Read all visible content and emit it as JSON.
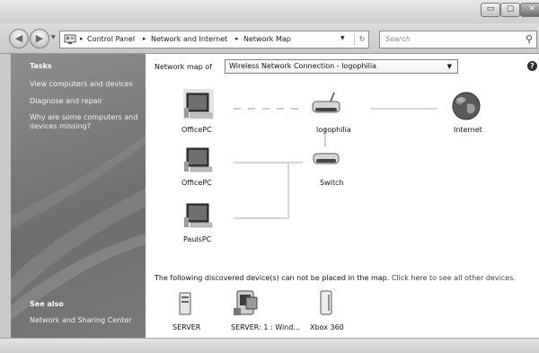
{
  "window": {
    "controls": {
      "minimize": "▭",
      "maximize": "▢",
      "close": "✕"
    }
  },
  "address_bar": {
    "back": "◀",
    "forward": "▶",
    "breadcrumb": [
      "Control Panel",
      "Network and Internet",
      "Network Map"
    ],
    "separator": "▸",
    "refresh": "↻",
    "search_placeholder": "Search"
  },
  "tasks": {
    "heading": "Tasks",
    "items": [
      "View computers and devices",
      "Diagnose and repair",
      "Why are some computers and",
      "devices missing?"
    ],
    "see_also_heading": "See also",
    "see_also_items": [
      "Network and Sharing Center"
    ]
  },
  "network_map": {
    "label": "Network map of",
    "selected_connection": "Wireless Network Connection - logophilia",
    "dropdown_arrow": "▼",
    "help": "?",
    "devices": {
      "computer1": "OfficePC",
      "router": "logophilia",
      "internet": "Internet",
      "computer2": "OfficePC",
      "switch": "Switch",
      "computer3": "PaulsPC"
    },
    "unplaced_message": "The following discovered device(s) can not be placed in the map.",
    "unplaced_link": "Click here to see all other devices.",
    "unplaced_devices": [
      "SERVER",
      "SERVER: 1 : Wind...",
      "Xbox 360"
    ]
  }
}
